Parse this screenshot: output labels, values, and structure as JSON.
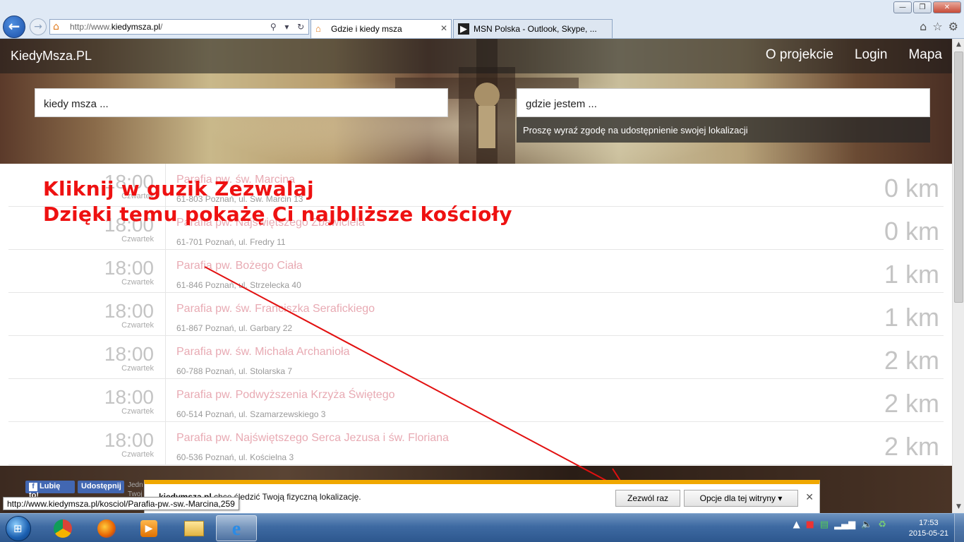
{
  "browser": {
    "url_prefix": "http://www.",
    "url_domain": "kiedymsza.pl",
    "url_suffix": "/",
    "tabs": [
      {
        "label": "Gdzie i kiedy msza"
      },
      {
        "label": "MSN Polska - Outlook, Skype, ..."
      }
    ]
  },
  "site": {
    "brand": "KiedyMsza.PL",
    "nav": [
      "O projekcie",
      "Login",
      "Mapa"
    ],
    "search_when_placeholder": "kiedy msza ...",
    "search_where_placeholder": "gdzie jestem ...",
    "geo_hint": "Proszę wyraź zgodę na udostępnienie swojej lokalizacji"
  },
  "rows": [
    {
      "time": "18:00",
      "day": "Czwartek",
      "name": "Parafia pw. św. Marcina",
      "addr": "61-803 Poznań, ul. Św. Marcin 13",
      "dist": "0 km"
    },
    {
      "time": "18:00",
      "day": "Czwartek",
      "name": "Parafia pw. Najświętszego Zbawiciela",
      "addr": "61-701 Poznań, ul. Fredry 11",
      "dist": "0 km"
    },
    {
      "time": "18:00",
      "day": "Czwartek",
      "name": "Parafia pw. Bożego Ciała",
      "addr": "61-846 Poznań, ul. Strzelecka 40",
      "dist": "1 km"
    },
    {
      "time": "18:00",
      "day": "Czwartek",
      "name": "Parafia pw. św. Franciszka Serafickiego",
      "addr": "61-867 Poznań, ul. Garbary 22",
      "dist": "1 km"
    },
    {
      "time": "18:00",
      "day": "Czwartek",
      "name": "Parafia pw. św. Michała Archanioła",
      "addr": "60-788 Poznań, ul. Stolarska 7",
      "dist": "2 km"
    },
    {
      "time": "18:00",
      "day": "Czwartek",
      "name": "Parafia pw. Podwyższenia Krzyża Świętego",
      "addr": "60-514 Poznań, ul. Szamarzewskiego 3",
      "dist": "2 km"
    },
    {
      "time": "18:00",
      "day": "Czwartek",
      "name": "Parafia pw. Najświętszego Serca Jezusa i św. Floriana",
      "addr": "60-536 Poznań, ul. Kościelna 3",
      "dist": "2 km"
    }
  ],
  "footer": {
    "fb_like": "Lubię to!",
    "fb_share": "Udostępnij",
    "side_small_1": "Jedn",
    "side_small_2": "Twoj"
  },
  "annotation": {
    "line1": "Kliknij w guzik Zezwalaj",
    "line2": "Dzięki temu pokażę Ci najbliższe kościoły"
  },
  "status_url": "http://www.kiedymsza.pl/kosciol/Parafia-pw.-sw.-Marcina,259",
  "notification": {
    "text_bold": "kiedymsza.pl",
    "text_rest": " chce śledzić Twoją fizyczną lokalizację.",
    "allow_once": "Zezwól raz",
    "site_options": "Opcje dla tej witryny"
  },
  "taskbar": {
    "time": "17:53",
    "date": "2015-05-21"
  },
  "colors": {
    "annotation": "#ee1111",
    "notify_accent": "#f0a800",
    "church_link": "#e8aab3"
  }
}
